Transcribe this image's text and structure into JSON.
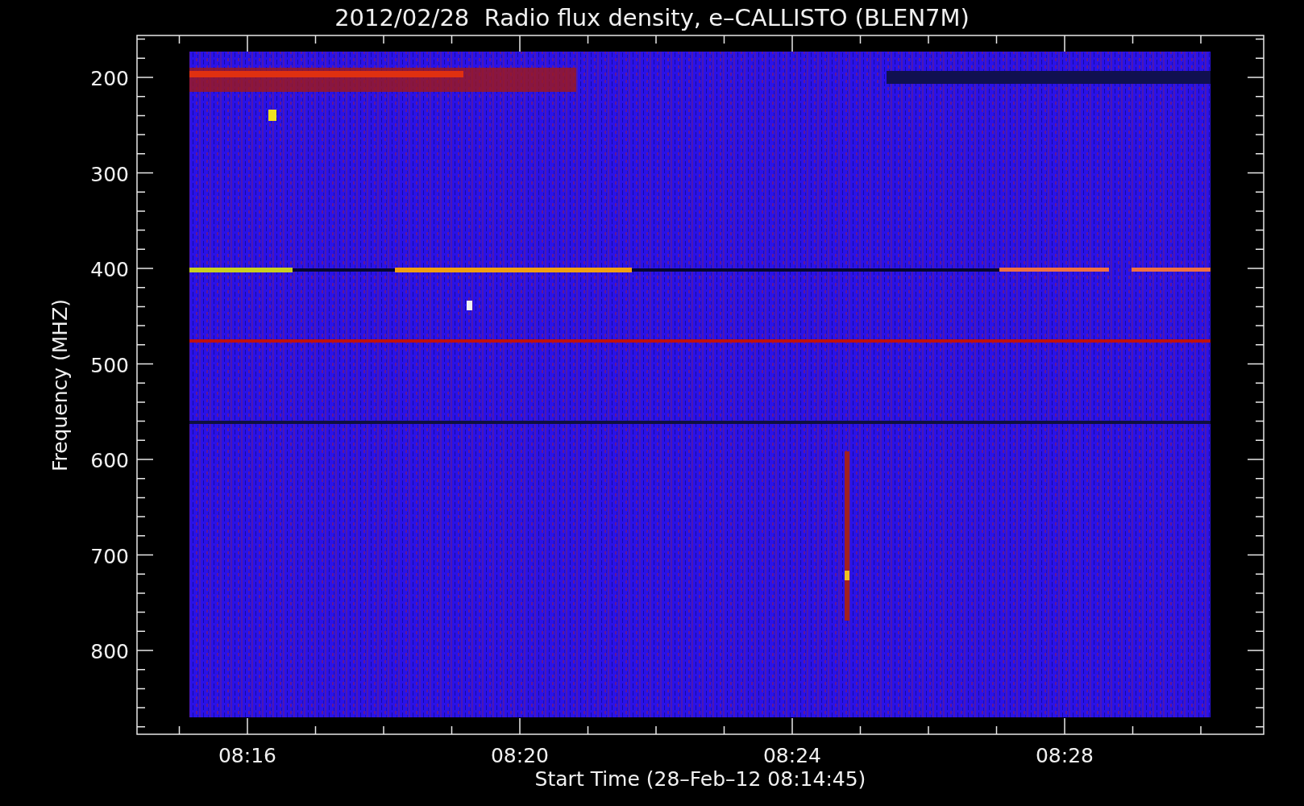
{
  "title": "2012/02/28  Radio flux density, e–CALLISTO (BLEN7M)",
  "y_axis": {
    "label": "Frequency (MHZ)",
    "ticks": [
      "200",
      "300",
      "400",
      "500",
      "600",
      "700",
      "800"
    ]
  },
  "x_axis": {
    "label": "Start Time (28–Feb–12 08:14:45)",
    "ticks": [
      "08:16",
      "08:20",
      "08:24",
      "08:28"
    ]
  }
}
